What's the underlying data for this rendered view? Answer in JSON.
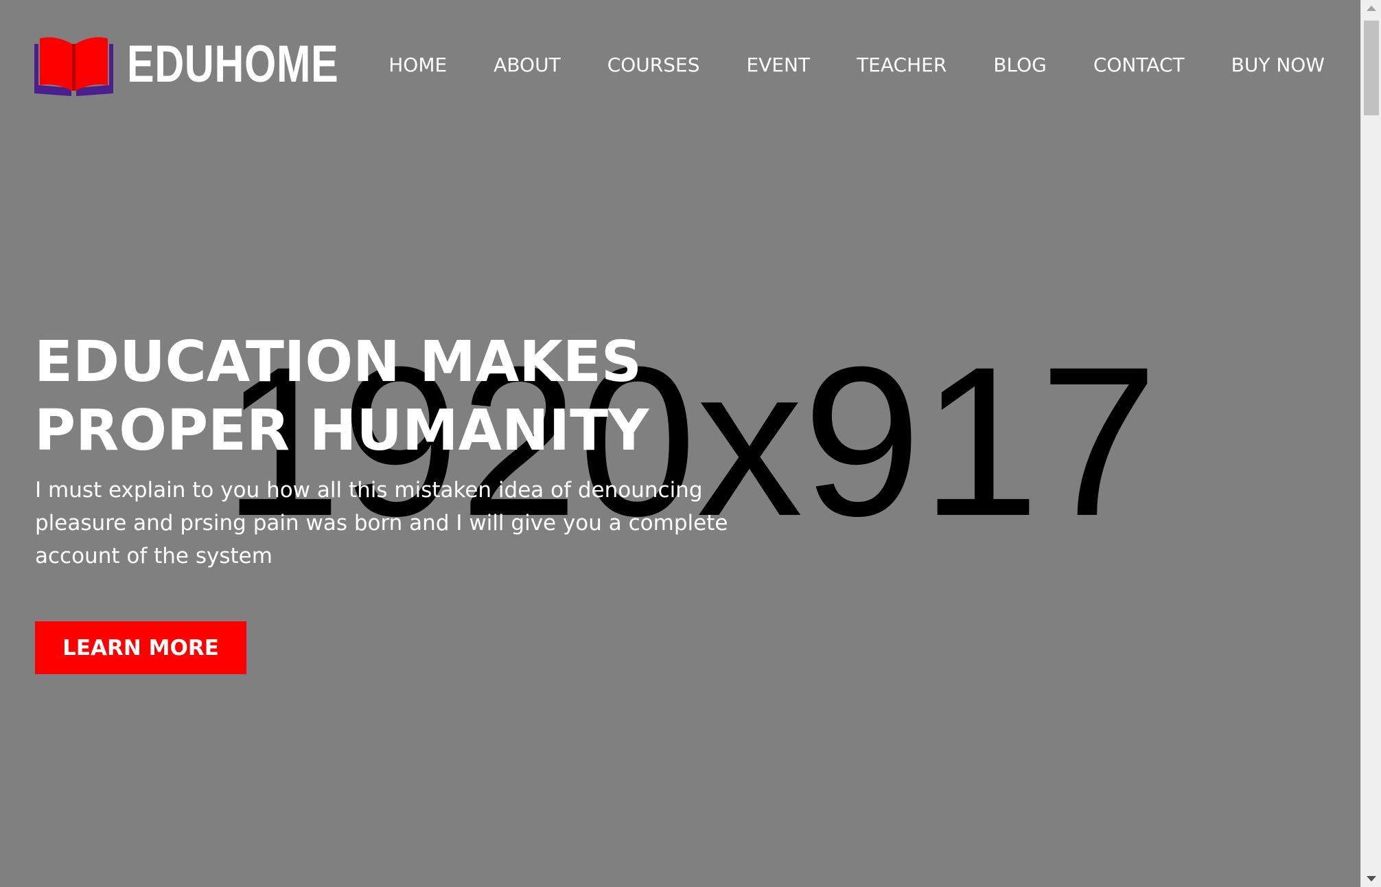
{
  "placeholder": {
    "dimensions_label": "1920x917"
  },
  "header": {
    "logo_text": "EDUHOME",
    "nav": [
      {
        "label": "HOME"
      },
      {
        "label": "ABOUT"
      },
      {
        "label": "COURSES"
      },
      {
        "label": "EVENT"
      },
      {
        "label": "TEACHER"
      },
      {
        "label": "BLOG"
      },
      {
        "label": "CONTACT"
      },
      {
        "label": "BUY NOW"
      }
    ]
  },
  "hero": {
    "title_line1": "EDUCATION MAKES",
    "title_line2": "PROPER HUMANITY",
    "description": "I must explain to you how all this mistaken idea of denouncing pleasure and prsing pain was born and I will give you a complete account of the system",
    "cta_label": "LEARN MORE"
  },
  "colors": {
    "background": "#808080",
    "accent": "#ff0000",
    "logo_book_red": "#ff0000",
    "logo_book_purple": "#4a1f8c",
    "text": "#ffffff"
  },
  "icons": {
    "logo": "open-book-icon"
  }
}
